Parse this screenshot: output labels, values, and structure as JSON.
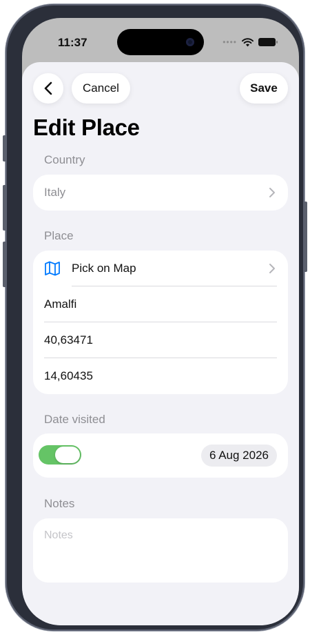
{
  "status_bar": {
    "time": "11:37"
  },
  "nav": {
    "back_icon": "chevron-left-icon",
    "cancel_label": "Cancel",
    "save_label": "Save"
  },
  "page_title": "Edit Place",
  "country": {
    "label": "Country",
    "value": "Italy"
  },
  "place": {
    "label": "Place",
    "pick_on_map_label": "Pick on Map",
    "map_icon": "map-icon",
    "name": "Amalfi",
    "latitude": "40,63471",
    "longitude": "14,60435"
  },
  "date_visited": {
    "label": "Date visited",
    "toggle_on": true,
    "date": "6 Aug 2026"
  },
  "notes": {
    "label": "Notes",
    "placeholder": "Notes"
  },
  "colors": {
    "accent": "#007aff",
    "toggle_on": "#65c466",
    "background": "#f2f2f7"
  }
}
